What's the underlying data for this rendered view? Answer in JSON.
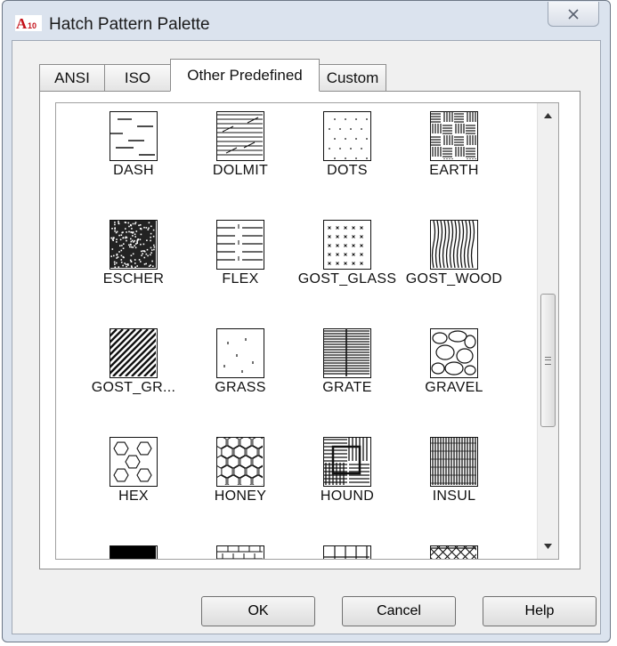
{
  "window": {
    "title": "Hatch Pattern Palette",
    "app_icon_text": "A",
    "app_icon_subtext": "10"
  },
  "tabs": [
    {
      "label": "ANSI",
      "active": false
    },
    {
      "label": "ISO",
      "active": false
    },
    {
      "label": "Other Predefined",
      "active": true
    },
    {
      "label": "Custom",
      "active": false
    }
  ],
  "patterns": [
    {
      "name": "DASH",
      "icon": "dash-pattern"
    },
    {
      "name": "DOLMIT",
      "icon": "dolmit-pattern"
    },
    {
      "name": "DOTS",
      "icon": "dots-pattern"
    },
    {
      "name": "EARTH",
      "icon": "earth-pattern"
    },
    {
      "name": "ESCHER",
      "icon": "escher-pattern"
    },
    {
      "name": "FLEX",
      "icon": "flex-pattern"
    },
    {
      "name": "GOST_GLASS",
      "icon": "gost-glass-pattern"
    },
    {
      "name": "GOST_WOOD",
      "icon": "gost-wood-pattern"
    },
    {
      "name": "GOST_GR...",
      "icon": "gost-ground-pattern"
    },
    {
      "name": "GRASS",
      "icon": "grass-pattern"
    },
    {
      "name": "GRATE",
      "icon": "grate-pattern"
    },
    {
      "name": "GRAVEL",
      "icon": "gravel-pattern"
    },
    {
      "name": "HEX",
      "icon": "hex-pattern"
    },
    {
      "name": "HONEY",
      "icon": "honey-pattern"
    },
    {
      "name": "HOUND",
      "icon": "hound-pattern"
    },
    {
      "name": "INSUL",
      "icon": "insul-pattern"
    }
  ],
  "partial_row_icons": [
    "solid-pattern",
    "brick-pattern",
    "grid-pattern",
    "net-pattern"
  ],
  "buttons": {
    "ok": "OK",
    "cancel": "Cancel",
    "help": "Help"
  },
  "scroll": {
    "position": 0.55
  }
}
